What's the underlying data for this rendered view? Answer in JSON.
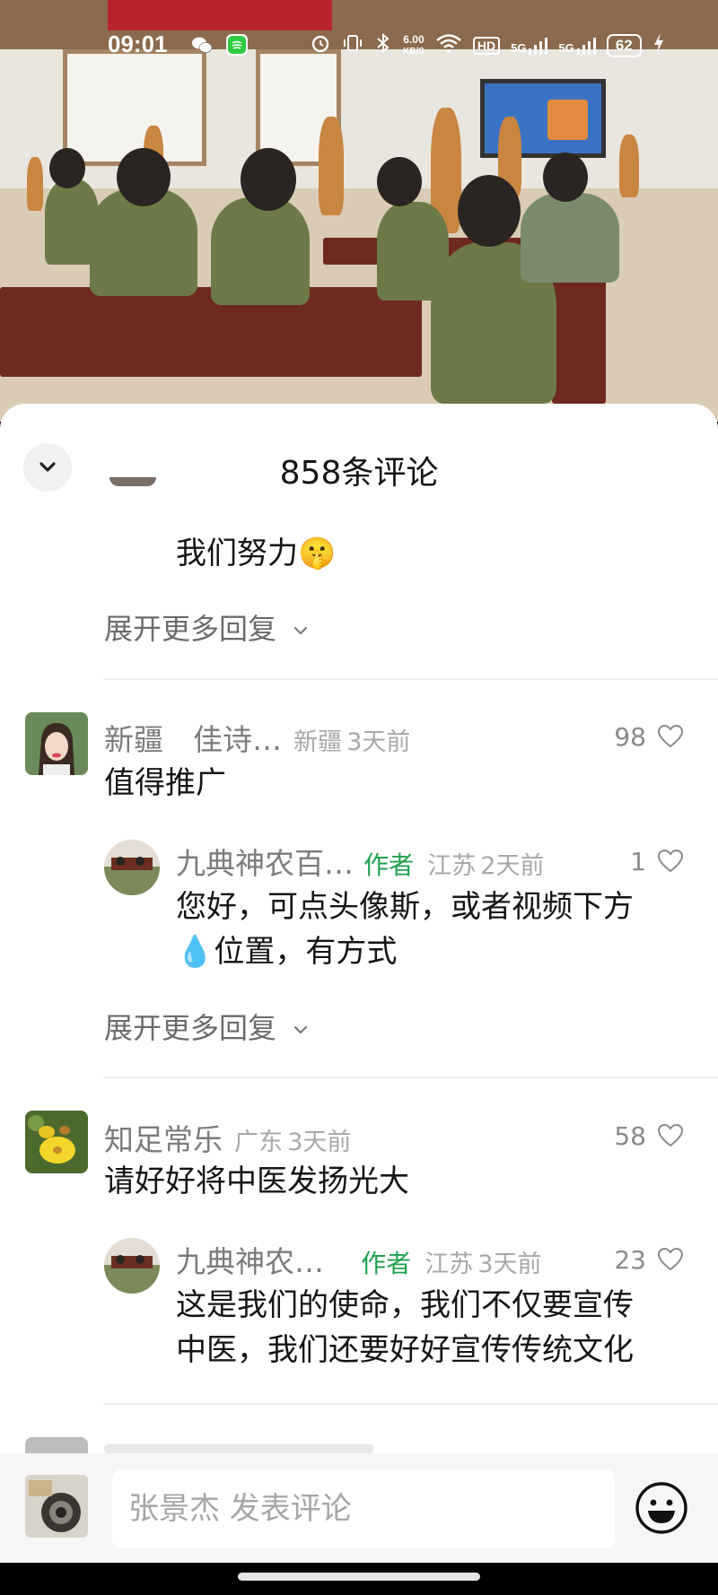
{
  "status_bar": {
    "time": "09:01",
    "net_speed": "6.00",
    "net_speed_unit": "KB/S",
    "hd_label": "HD",
    "signal_1": "5G",
    "signal_2": "5G",
    "battery": "62",
    "icons": [
      "wechat-icon",
      "app-notification-icon",
      "alarm-icon",
      "vibrate-icon",
      "bluetooth-icon",
      "wifi-icon",
      "charging-icon"
    ]
  },
  "sheet": {
    "title": "858条评论"
  },
  "partial_reply": {
    "text": "我们努力🤫"
  },
  "expand_label": "展开更多回复",
  "comments": [
    {
      "name": "新疆　佳诗…",
      "location": "新疆",
      "time": "3天前",
      "text": "值得推广",
      "likes": "98",
      "reply": {
        "name": "九典神农百…",
        "badge": "作者",
        "location": "江苏",
        "time": "2天前",
        "likes": "1",
        "text_line1": "您好，可点头像斯，或者视频下方",
        "text_line2": "💧位置，有方式"
      }
    },
    {
      "name": "知足常乐",
      "location": "广东",
      "time": "3天前",
      "text": "请好好将中医发扬光大",
      "likes": "58",
      "reply": {
        "name": "九典神农…",
        "badge": "作者",
        "location": "江苏",
        "time": "3天前",
        "likes": "23",
        "text_line1": "这是我们的使命，我们不仅要宣传",
        "text_line2": "中医，我们还要好好宣传传统文化"
      }
    }
  ],
  "input": {
    "placeholder": "张景杰 发表评论"
  },
  "colors": {
    "author_badge": "#1fa24f",
    "sheet_bg": "#ffffff",
    "input_bar_bg": "#f6f6f6"
  }
}
